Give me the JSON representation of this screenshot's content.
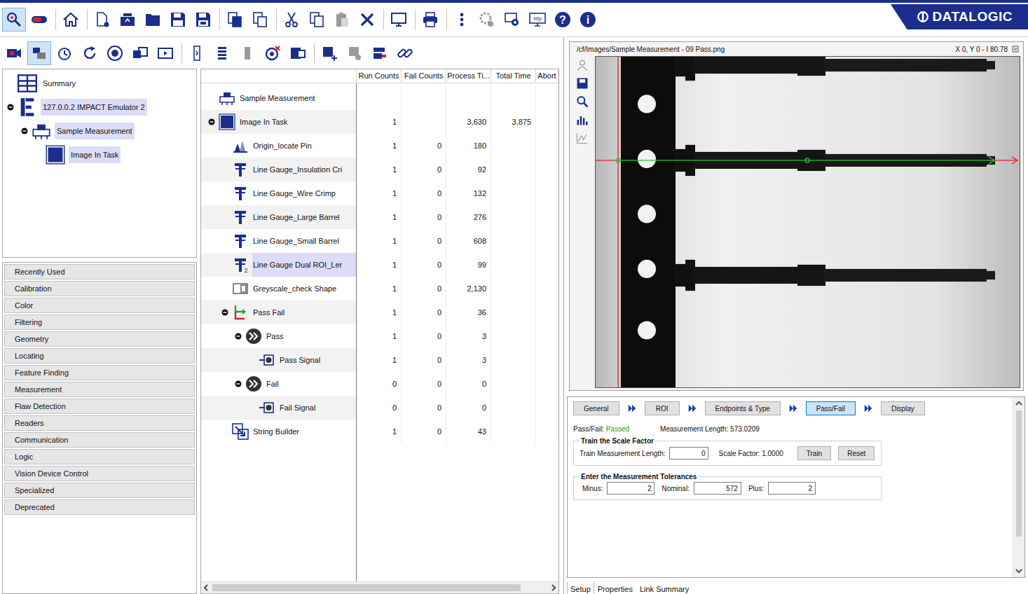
{
  "brand": {
    "name": "DATALOGIC"
  },
  "main_toolbar": {
    "buttons": [
      {
        "selected": true,
        "disabled": false,
        "text": ""
      },
      {
        "selected": false,
        "disabled": false,
        "text": ""
      },
      {
        "selected": false,
        "disabled": false,
        "text": ""
      },
      {
        "selected": false,
        "disabled": false,
        "text": ""
      },
      {
        "selected": false,
        "disabled": false,
        "text": ""
      },
      {
        "selected": false,
        "disabled": false,
        "text": ""
      },
      {
        "selected": false,
        "disabled": false,
        "text": ""
      },
      {
        "selected": false,
        "disabled": false,
        "text": ""
      },
      {
        "selected": false,
        "disabled": false,
        "text": ""
      },
      {
        "selected": false,
        "disabled": false,
        "text": ""
      },
      {
        "selected": false,
        "disabled": false,
        "text": ""
      },
      {
        "selected": false,
        "disabled": false,
        "text": ""
      },
      {
        "selected": false,
        "disabled": true,
        "text": ""
      },
      {
        "selected": false,
        "disabled": false,
        "text": ""
      },
      {
        "selected": false,
        "disabled": false,
        "text": ""
      },
      {
        "selected": false,
        "disabled": false,
        "text": ""
      },
      {
        "selected": false,
        "disabled": false,
        "text": ""
      },
      {
        "selected": false,
        "disabled": true,
        "text": ""
      },
      {
        "selected": false,
        "disabled": false,
        "text": ""
      },
      {
        "selected": false,
        "disabled": false,
        "text": "http"
      },
      {
        "selected": false,
        "disabled": false,
        "text": "?"
      },
      {
        "selected": false,
        "disabled": false,
        "text": "i"
      }
    ]
  },
  "tool_toolbar": {
    "buttons": [
      {
        "selected": false,
        "disabled": false
      },
      {
        "selected": true,
        "disabled": false
      },
      {
        "selected": false,
        "disabled": false
      },
      {
        "selected": false,
        "disabled": false
      },
      {
        "selected": false,
        "disabled": false
      },
      {
        "selected": false,
        "disabled": false
      },
      {
        "selected": false,
        "disabled": false
      },
      {
        "selected": false,
        "disabled": false
      },
      {
        "selected": false,
        "disabled": false
      },
      {
        "selected": false,
        "disabled": true
      },
      {
        "selected": false,
        "disabled": false
      },
      {
        "selected": false,
        "disabled": false
      },
      {
        "selected": false,
        "disabled": false
      },
      {
        "selected": false,
        "disabled": true
      },
      {
        "selected": false,
        "disabled": false
      },
      {
        "selected": false,
        "disabled": false
      }
    ]
  },
  "project_tree": [
    {
      "label": "Summary",
      "kind": "grid",
      "selected": false,
      "has_toggle": false,
      "expanded": false,
      "children": []
    },
    {
      "label": "127.0.0.2 IMPACT Emulator 2",
      "kind": "device",
      "selected": true,
      "has_toggle": true,
      "expanded": true,
      "children": [
        {
          "label": "Sample Measurement",
          "kind": "task",
          "selected": true,
          "has_toggle": true,
          "expanded": true,
          "children": [
            {
              "label": "Image In Task",
              "kind": "image",
              "selected": true,
              "has_toggle": false,
              "expanded": false,
              "children": []
            }
          ]
        }
      ]
    }
  ],
  "tool_categories": [
    "Recently Used",
    "Calibration",
    "Color",
    "Filtering",
    "Geometry",
    "Locating",
    "Feature Finding",
    "Measurement",
    "Flaw Detection",
    "Readers",
    "Communication",
    "Logic",
    "Vision Device Control",
    "Specialized",
    "Deprecated"
  ],
  "task_table": {
    "columns": [
      "Run Counts",
      "Fail Counts",
      "Process Ti...",
      "Total Time",
      "Abort"
    ],
    "rows": [
      {
        "name": "Sample Measurement",
        "kind": "task",
        "badge": "",
        "selected": false,
        "has_toggle": false,
        "expanded": true,
        "values": [
          "",
          "",
          "",
          "",
          ""
        ],
        "children": [
          {
            "name": "Image In Task",
            "kind": "image",
            "badge": "",
            "selected": false,
            "has_toggle": true,
            "expanded": true,
            "values": [
              "1",
              "",
              "3,630",
              "3,875",
              ""
            ],
            "children": [
              {
                "name": "Origin_locate Pin",
                "kind": "locate",
                "badge": "",
                "selected": false,
                "has_toggle": false,
                "expanded": false,
                "values": [
                  "1",
                  "0",
                  "180",
                  "",
                  ""
                ],
                "children": []
              },
              {
                "name": "Line Gauge_Insulation Cri",
                "kind": "gauge",
                "badge": "",
                "selected": false,
                "has_toggle": false,
                "expanded": false,
                "values": [
                  "1",
                  "0",
                  "92",
                  "",
                  ""
                ],
                "children": []
              },
              {
                "name": "Line Gauge_Wire Crimp",
                "kind": "gauge",
                "badge": "",
                "selected": false,
                "has_toggle": false,
                "expanded": false,
                "values": [
                  "1",
                  "0",
                  "132",
                  "",
                  ""
                ],
                "children": []
              },
              {
                "name": "Line Gauge_Large Barrel",
                "kind": "gauge",
                "badge": "",
                "selected": false,
                "has_toggle": false,
                "expanded": false,
                "values": [
                  "1",
                  "0",
                  "276",
                  "",
                  ""
                ],
                "children": []
              },
              {
                "name": "Line Gauge_Small Barrel",
                "kind": "gauge",
                "badge": "",
                "selected": false,
                "has_toggle": false,
                "expanded": false,
                "values": [
                  "1",
                  "0",
                  "608",
                  "",
                  ""
                ],
                "children": []
              },
              {
                "name": "Line Gauge Dual ROI_Ler",
                "kind": "gauge",
                "badge": "2",
                "selected": true,
                "has_toggle": false,
                "expanded": false,
                "values": [
                  "1",
                  "0",
                  "99",
                  "",
                  ""
                ],
                "children": []
              },
              {
                "name": "Greyscale_check Shape",
                "kind": "shape",
                "badge": "",
                "selected": false,
                "has_toggle": false,
                "expanded": false,
                "values": [
                  "1",
                  "0",
                  "2,130",
                  "",
                  ""
                ],
                "children": []
              },
              {
                "name": "Pass Fail",
                "kind": "passfail",
                "badge": "",
                "selected": false,
                "has_toggle": true,
                "expanded": true,
                "values": [
                  "1",
                  "0",
                  "36",
                  "",
                  ""
                ],
                "children": [
                  {
                    "name": "Pass",
                    "kind": "branch",
                    "badge": "",
                    "selected": false,
                    "has_toggle": true,
                    "expanded": true,
                    "values": [
                      "1",
                      "0",
                      "3",
                      "",
                      ""
                    ],
                    "children": [
                      {
                        "name": "Pass Signal",
                        "kind": "signal",
                        "badge": "",
                        "selected": false,
                        "has_toggle": false,
                        "expanded": false,
                        "values": [
                          "1",
                          "0",
                          "3",
                          "",
                          ""
                        ],
                        "children": []
                      }
                    ]
                  },
                  {
                    "name": "Fail",
                    "kind": "branch",
                    "badge": "",
                    "selected": false,
                    "has_toggle": true,
                    "expanded": true,
                    "values": [
                      "0",
                      "0",
                      "0",
                      "",
                      ""
                    ],
                    "children": [
                      {
                        "name": "Fail Signal",
                        "kind": "signal",
                        "badge": "",
                        "selected": false,
                        "has_toggle": false,
                        "expanded": false,
                        "values": [
                          "0",
                          "0",
                          "0",
                          "",
                          ""
                        ],
                        "children": []
                      }
                    ]
                  }
                ]
              },
              {
                "name": "String Builder",
                "kind": "string",
                "badge": "",
                "selected": false,
                "has_toggle": false,
                "expanded": false,
                "values": [
                  "1",
                  "0",
                  "43",
                  "",
                  ""
                ],
                "children": []
              }
            ]
          }
        ]
      }
    ]
  },
  "image_view": {
    "path": "/cf/Images/Sample Measurement - 09 Pass.png",
    "readout": "X 0, Y 0 - I 80.78",
    "tools": [
      {
        "disabled": true
      },
      {
        "disabled": false
      },
      {
        "disabled": false
      },
      {
        "disabled": false
      },
      {
        "disabled": true
      }
    ]
  },
  "setup": {
    "steps": [
      {
        "label": "General",
        "selected": false
      },
      {
        "label": "ROI",
        "selected": false
      },
      {
        "label": "Endpoints & Type",
        "selected": false
      },
      {
        "label": "Pass/Fail",
        "selected": true
      },
      {
        "label": "Display",
        "selected": false
      }
    ],
    "result": {
      "pass_fail_label": "Pass/Fail:",
      "pass_fail_value": "Passed",
      "passed": true,
      "length_label": "Measurement Length:",
      "length_value": "573.0209"
    },
    "scale_group": {
      "title": "Train the Scale Factor",
      "length_label": "Train Measurement Length:",
      "length_value": "0",
      "scale_label": "Scale Factor:",
      "scale_value": "1.0000",
      "buttons": [
        "Train",
        "Reset"
      ]
    },
    "tolerance_group": {
      "title": "Enter the Measurement Tolerances",
      "fields": [
        {
          "label": "Minus:",
          "value": "2"
        },
        {
          "label": "Nominal:",
          "value": "572"
        },
        {
          "label": "Plus:",
          "value": "2"
        }
      ]
    }
  },
  "bottom_tabs": [
    {
      "label": "Setup",
      "selected": true
    },
    {
      "label": "Properties",
      "selected": false
    },
    {
      "label": "Link Summary",
      "selected": false
    }
  ]
}
